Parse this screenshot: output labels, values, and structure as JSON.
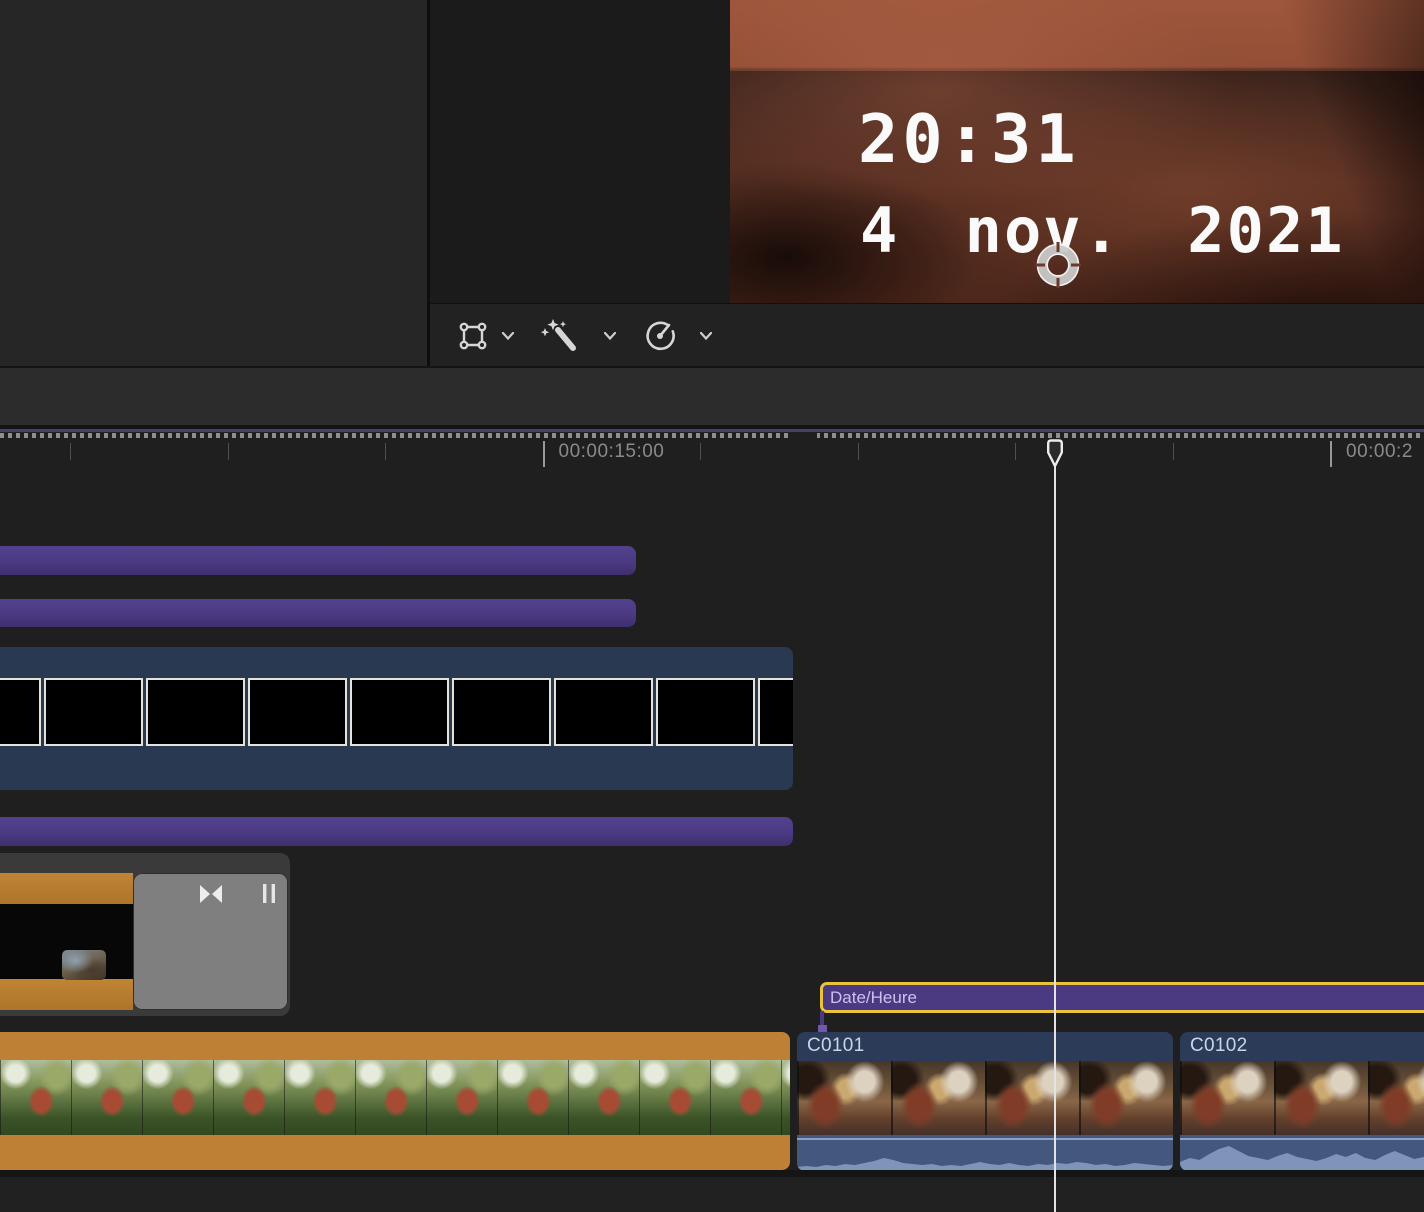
{
  "colors": {
    "accent_purple": "#4b3a82",
    "accent_orange": "#bd8034",
    "accent_blue": "#2c3c58",
    "selection_yellow": "#eac33e",
    "transition_gray": "#7f7f7f",
    "playhead": "#e3e3e3"
  },
  "viewer": {
    "overlay_time": "20:31",
    "overlay_date": "4 nov. 2021",
    "toolbar_icons": [
      "transform-tool",
      "enhancements-tool",
      "retime-tool"
    ]
  },
  "ruler": {
    "tick_start": 70,
    "tick_spacing": 157.5,
    "tick_count": 9,
    "major_ticks": [
      3,
      8
    ],
    "labels": [
      {
        "index": 3,
        "text": "00:00:15:00"
      },
      {
        "index": 8,
        "text": "00:00:2"
      }
    ]
  },
  "timeline": {
    "clips": {
      "dateheure": {
        "label": "Date/Heure"
      },
      "c0101": {
        "label": "C0101",
        "waveform": [
          4,
          5,
          4,
          6,
          5,
          7,
          6,
          8,
          10,
          13,
          11,
          8,
          7,
          6,
          7,
          5,
          6,
          5,
          7,
          9,
          7,
          6,
          8,
          6,
          5,
          7,
          6,
          8,
          7,
          9,
          8,
          6,
          7,
          5,
          6,
          8,
          7,
          6,
          5,
          6
        ]
      },
      "c0102": {
        "label": "C0102",
        "waveform": [
          9,
          13,
          11,
          17,
          22,
          25,
          20,
          15,
          13,
          11,
          15,
          18,
          14,
          12,
          10,
          13,
          17,
          14,
          18,
          13,
          11,
          16,
          20,
          16,
          12,
          14
        ]
      }
    },
    "filmstrip_frame_count": 9
  }
}
